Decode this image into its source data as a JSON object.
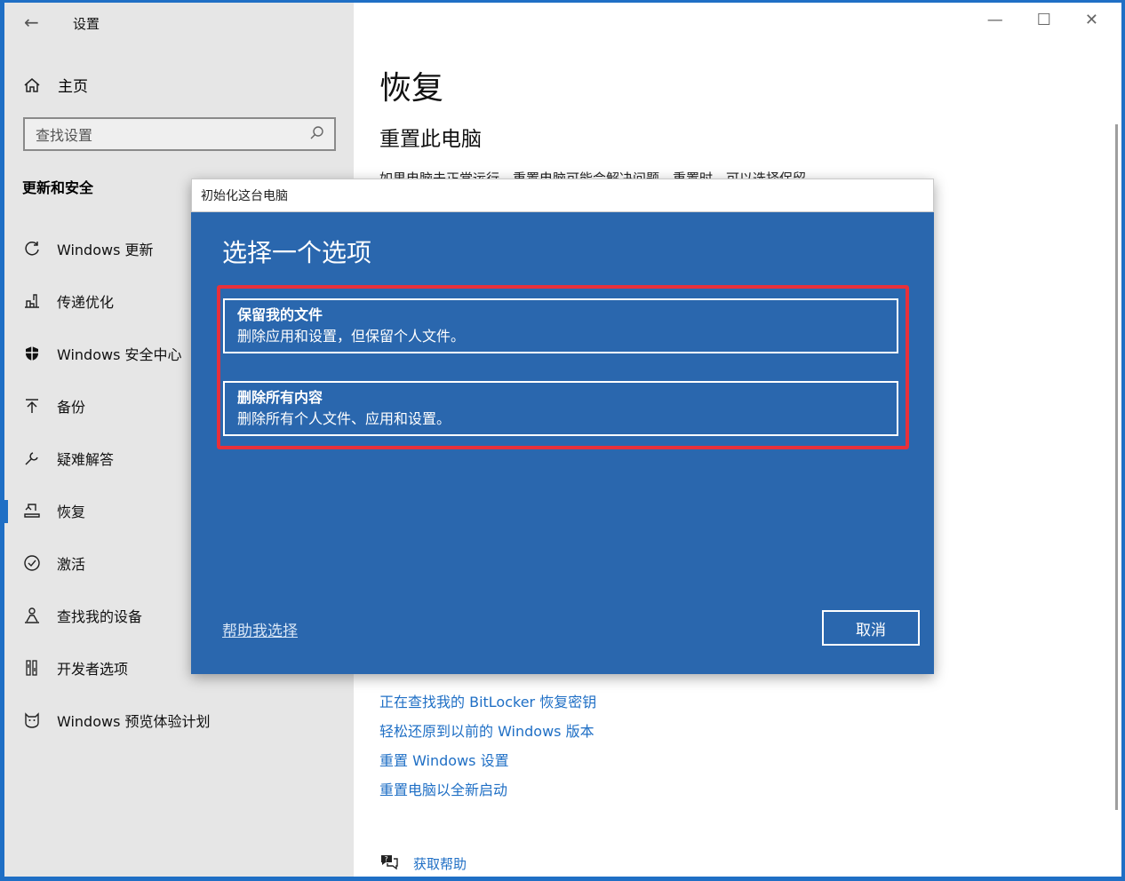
{
  "window": {
    "back_glyph": "←",
    "title": "设置",
    "controls": [
      "—",
      "☐",
      "✕"
    ]
  },
  "sidebar": {
    "home_label": "主页",
    "search_placeholder": "查找设置",
    "section_title": "更新和安全",
    "items": [
      {
        "label": "Windows 更新",
        "icon": "refresh-icon"
      },
      {
        "label": "传递优化",
        "icon": "delivery-icon"
      },
      {
        "label": "Windows 安全中心",
        "icon": "shield-icon"
      },
      {
        "label": "备份",
        "icon": "backup-arrow-icon"
      },
      {
        "label": "疑难解答",
        "icon": "wrench-icon"
      },
      {
        "label": "恢复",
        "icon": "recovery-icon",
        "active": true
      },
      {
        "label": "激活",
        "icon": "check-circle-icon"
      },
      {
        "label": "查找我的设备",
        "icon": "person-locate-icon"
      },
      {
        "label": "开发者选项",
        "icon": "developer-icon"
      },
      {
        "label": "Windows 预览体验计划",
        "icon": "insider-cat-icon"
      }
    ]
  },
  "main": {
    "page_title": "恢复",
    "subtitle": "重置此电脑",
    "description_partial": "如果电脑未正常运行，重置电脑可能会解决问题。重置时，可以选择保留",
    "links": [
      "正在查找我的 BitLocker 恢复密钥",
      "轻松还原到以前的 Windows 版本",
      "重置 Windows 设置",
      "重置电脑以全新启动"
    ],
    "help_label": "获取帮助"
  },
  "dialog": {
    "title": "初始化这台电脑",
    "heading": "选择一个选项",
    "options": [
      {
        "title": "保留我的文件",
        "desc": "删除应用和设置，但保留个人文件。"
      },
      {
        "title": "删除所有内容",
        "desc": "删除所有个人文件、应用和设置。"
      }
    ],
    "help_link": "帮助我选择",
    "cancel_label": "取消"
  },
  "colors": {
    "accent": "#1f6fc5",
    "dialog_bg": "#2a67ae",
    "highlight": "#e8303a",
    "sidebar_bg": "#e6e6e6"
  }
}
